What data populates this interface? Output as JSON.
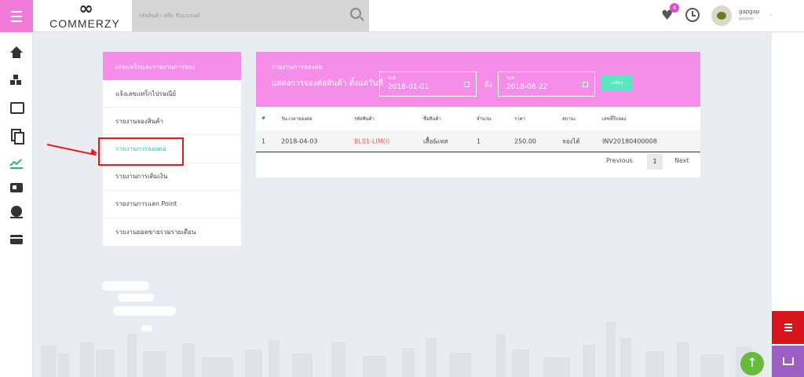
{
  "header": {
    "logo_text": "COMMERZY",
    "search_placeholder": "รหัสสินค้า หรือ ชื่อแบรนด์",
    "wishlist_count": "4",
    "username": "gapgap",
    "user_sub": "gapgap"
  },
  "sidebar_icons": [
    "home-icon",
    "boxes-icon",
    "gallery-icon",
    "copy-icon",
    "chart-icon",
    "id-card-icon",
    "money-icon",
    "credit-card-icon"
  ],
  "report_menu": {
    "title": "เลขแทร็กและรายงานการจอง",
    "items": [
      {
        "label": "แจ้งเลขแทร็กไปรษณีย์"
      },
      {
        "label": "รายงานจองสินค้า"
      },
      {
        "label": "รายงานการจองต่อ"
      },
      {
        "label": "รายงานการเติมเงิน"
      },
      {
        "label": "รายงานการแลก Point"
      },
      {
        "label": "รายงานยอดขายรวมรายเดือน"
      }
    ],
    "active_index": 2
  },
  "report": {
    "title": "รายงานการจองต่อ",
    "subtitle": "แสดงการจองต่อสินค้า ตั้งแต่วันที่",
    "from": {
      "label": "วันที่",
      "value": "2018-01-01"
    },
    "to_label": "ถึง",
    "to": {
      "label": "วันที่",
      "value": "2018-08-22"
    },
    "show_button": "แสดง",
    "columns": [
      "#",
      "วัน-เวลาจองต่อ",
      "รหัสสินค้า",
      "ชื่อสินค้า",
      "จำนวน",
      "ราคา",
      "สถานะ",
      "เลขที่ใบจอง"
    ],
    "rows": [
      [
        "1",
        "2018-04-03",
        "BL01-LIM(I)",
        "เสื้อ&เทส",
        "1",
        "250.00",
        "จองได้",
        "INV20180400008"
      ]
    ],
    "pager": {
      "previous": "Previous",
      "page": "1",
      "next": "Next"
    }
  },
  "colors": {
    "accent_pink": "#f48ee8",
    "active_green": "#2bd49a",
    "sku_red": "#ee5a4f",
    "fab_red": "#d8141d",
    "fab_purple": "#9b5ec3",
    "scroll_green": "#66bb3a"
  }
}
